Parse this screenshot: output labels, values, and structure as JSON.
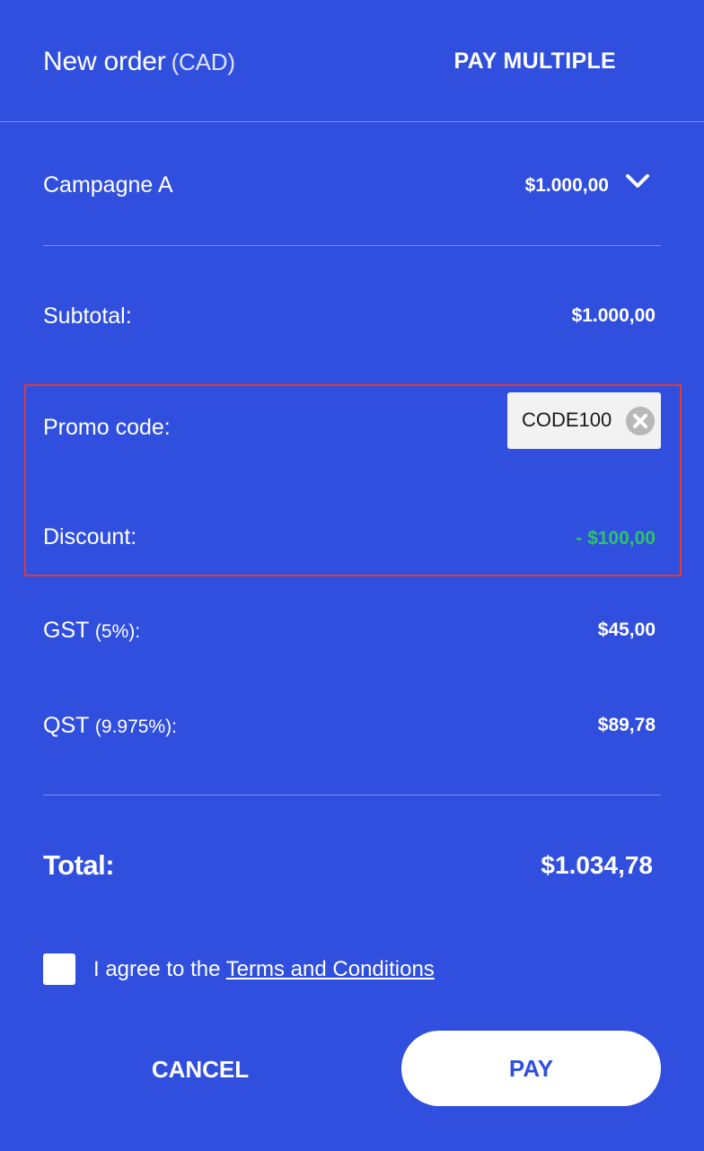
{
  "header": {
    "title": "New order",
    "currency": "(CAD)",
    "pay_multiple_label": "PAY MULTIPLE"
  },
  "campaign": {
    "name": "Campagne A",
    "amount": "$1.000,00",
    "toggle_icon": "chevron-down-icon"
  },
  "summary": {
    "subtotal_label": "Subtotal:",
    "subtotal_value": "$1.000,00",
    "promo_label": "Promo code:",
    "promo_code": "CODE100",
    "promo_clear_icon": "close-circle-icon",
    "discount_label": "Discount:",
    "discount_value": "- $100,00",
    "gst_label": "GST",
    "gst_rate": "(5%):",
    "gst_value": "$45,00",
    "qst_label": "QST",
    "qst_rate": "(9.975%):",
    "qst_value": "$89,78",
    "total_label": "Total:",
    "total_value": "$1.034,78"
  },
  "agreement": {
    "prefix": "I agree to the",
    "link_text": "Terms and Conditions",
    "checked": false
  },
  "actions": {
    "cancel_label": "CANCEL",
    "pay_label": "PAY"
  },
  "colors": {
    "panel_background": "#304fde",
    "discount_green": "#2ec36b",
    "highlight_border": "#e53a2d",
    "text": "#ffffff"
  }
}
